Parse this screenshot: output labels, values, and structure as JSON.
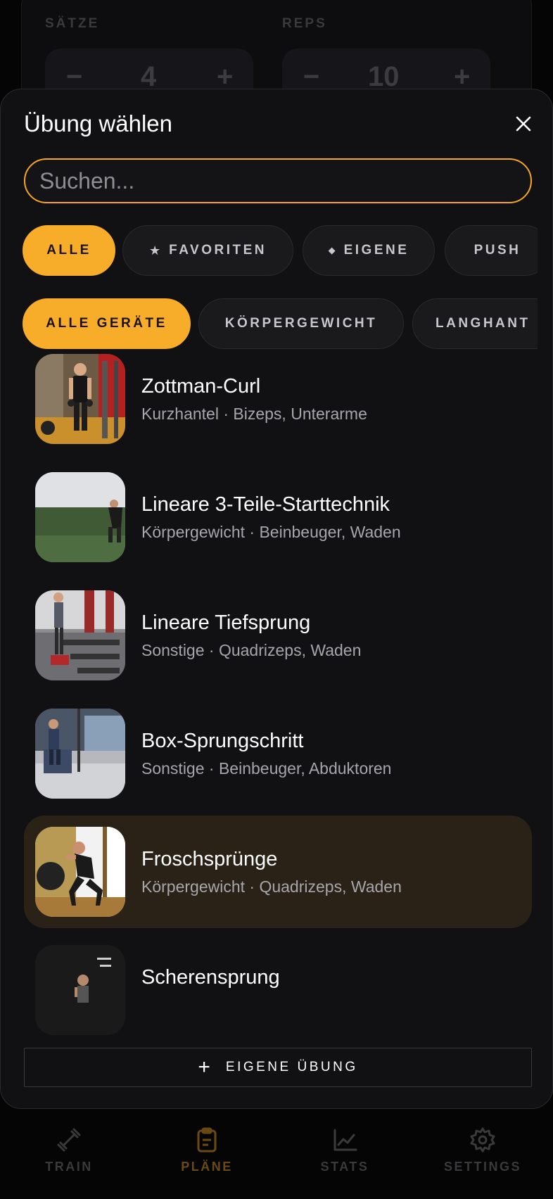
{
  "background": {
    "sets_label": "SÄTZE",
    "reps_label": "REPS",
    "sets_minus": "−",
    "sets_value": "4",
    "sets_plus": "+",
    "reps_minus": "−",
    "reps_value": "10",
    "reps_plus": "+"
  },
  "sheet": {
    "title": "Übung wählen",
    "search_placeholder": "Suchen...",
    "category_filters": [
      {
        "label": "ALLE",
        "icon": "",
        "active": true
      },
      {
        "label": "FAVORITEN",
        "icon": "star-icon",
        "active": false
      },
      {
        "label": "EIGENE",
        "icon": "diamond-icon",
        "active": false
      },
      {
        "label": "PUSH",
        "icon": "",
        "active": false
      }
    ],
    "equipment_filters": [
      {
        "label": "ALLE GERÄTE",
        "active": true
      },
      {
        "label": "KÖRPERGEWICHT",
        "active": false
      },
      {
        "label": "LANGHANT",
        "active": false
      }
    ],
    "exercises": [
      {
        "name": "Zottman-Curl",
        "meta": "Kurzhantel · Bizeps, Unterarme"
      },
      {
        "name": "Lineare 3-Teile-Starttechnik",
        "meta": "Körpergewicht · Beinbeuger, Waden"
      },
      {
        "name": "Lineare Tiefsprung",
        "meta": "Sonstige · Quadrizeps, Waden"
      },
      {
        "name": "Box-Sprungschritt",
        "meta": "Sonstige · Beinbeuger, Abduktoren"
      },
      {
        "name": "Froschsprünge",
        "meta": "Körpergewicht · Quadrizeps, Waden",
        "highlighted": true
      },
      {
        "name": "Scherensprung",
        "meta": ""
      }
    ],
    "add_button_label": "EIGENE ÜBUNG"
  },
  "nav": {
    "items": [
      {
        "label": "TRAIN",
        "icon": "dumbbell-icon"
      },
      {
        "label": "PLÄNE",
        "icon": "clipboard-icon",
        "active": true
      },
      {
        "label": "STATS",
        "icon": "chart-icon"
      },
      {
        "label": "SETTINGS",
        "icon": "gear-icon"
      }
    ]
  },
  "colors": {
    "accent": "#f8ad2a",
    "sheet_bg": "#111113",
    "highlight_row": "#2a2217"
  }
}
